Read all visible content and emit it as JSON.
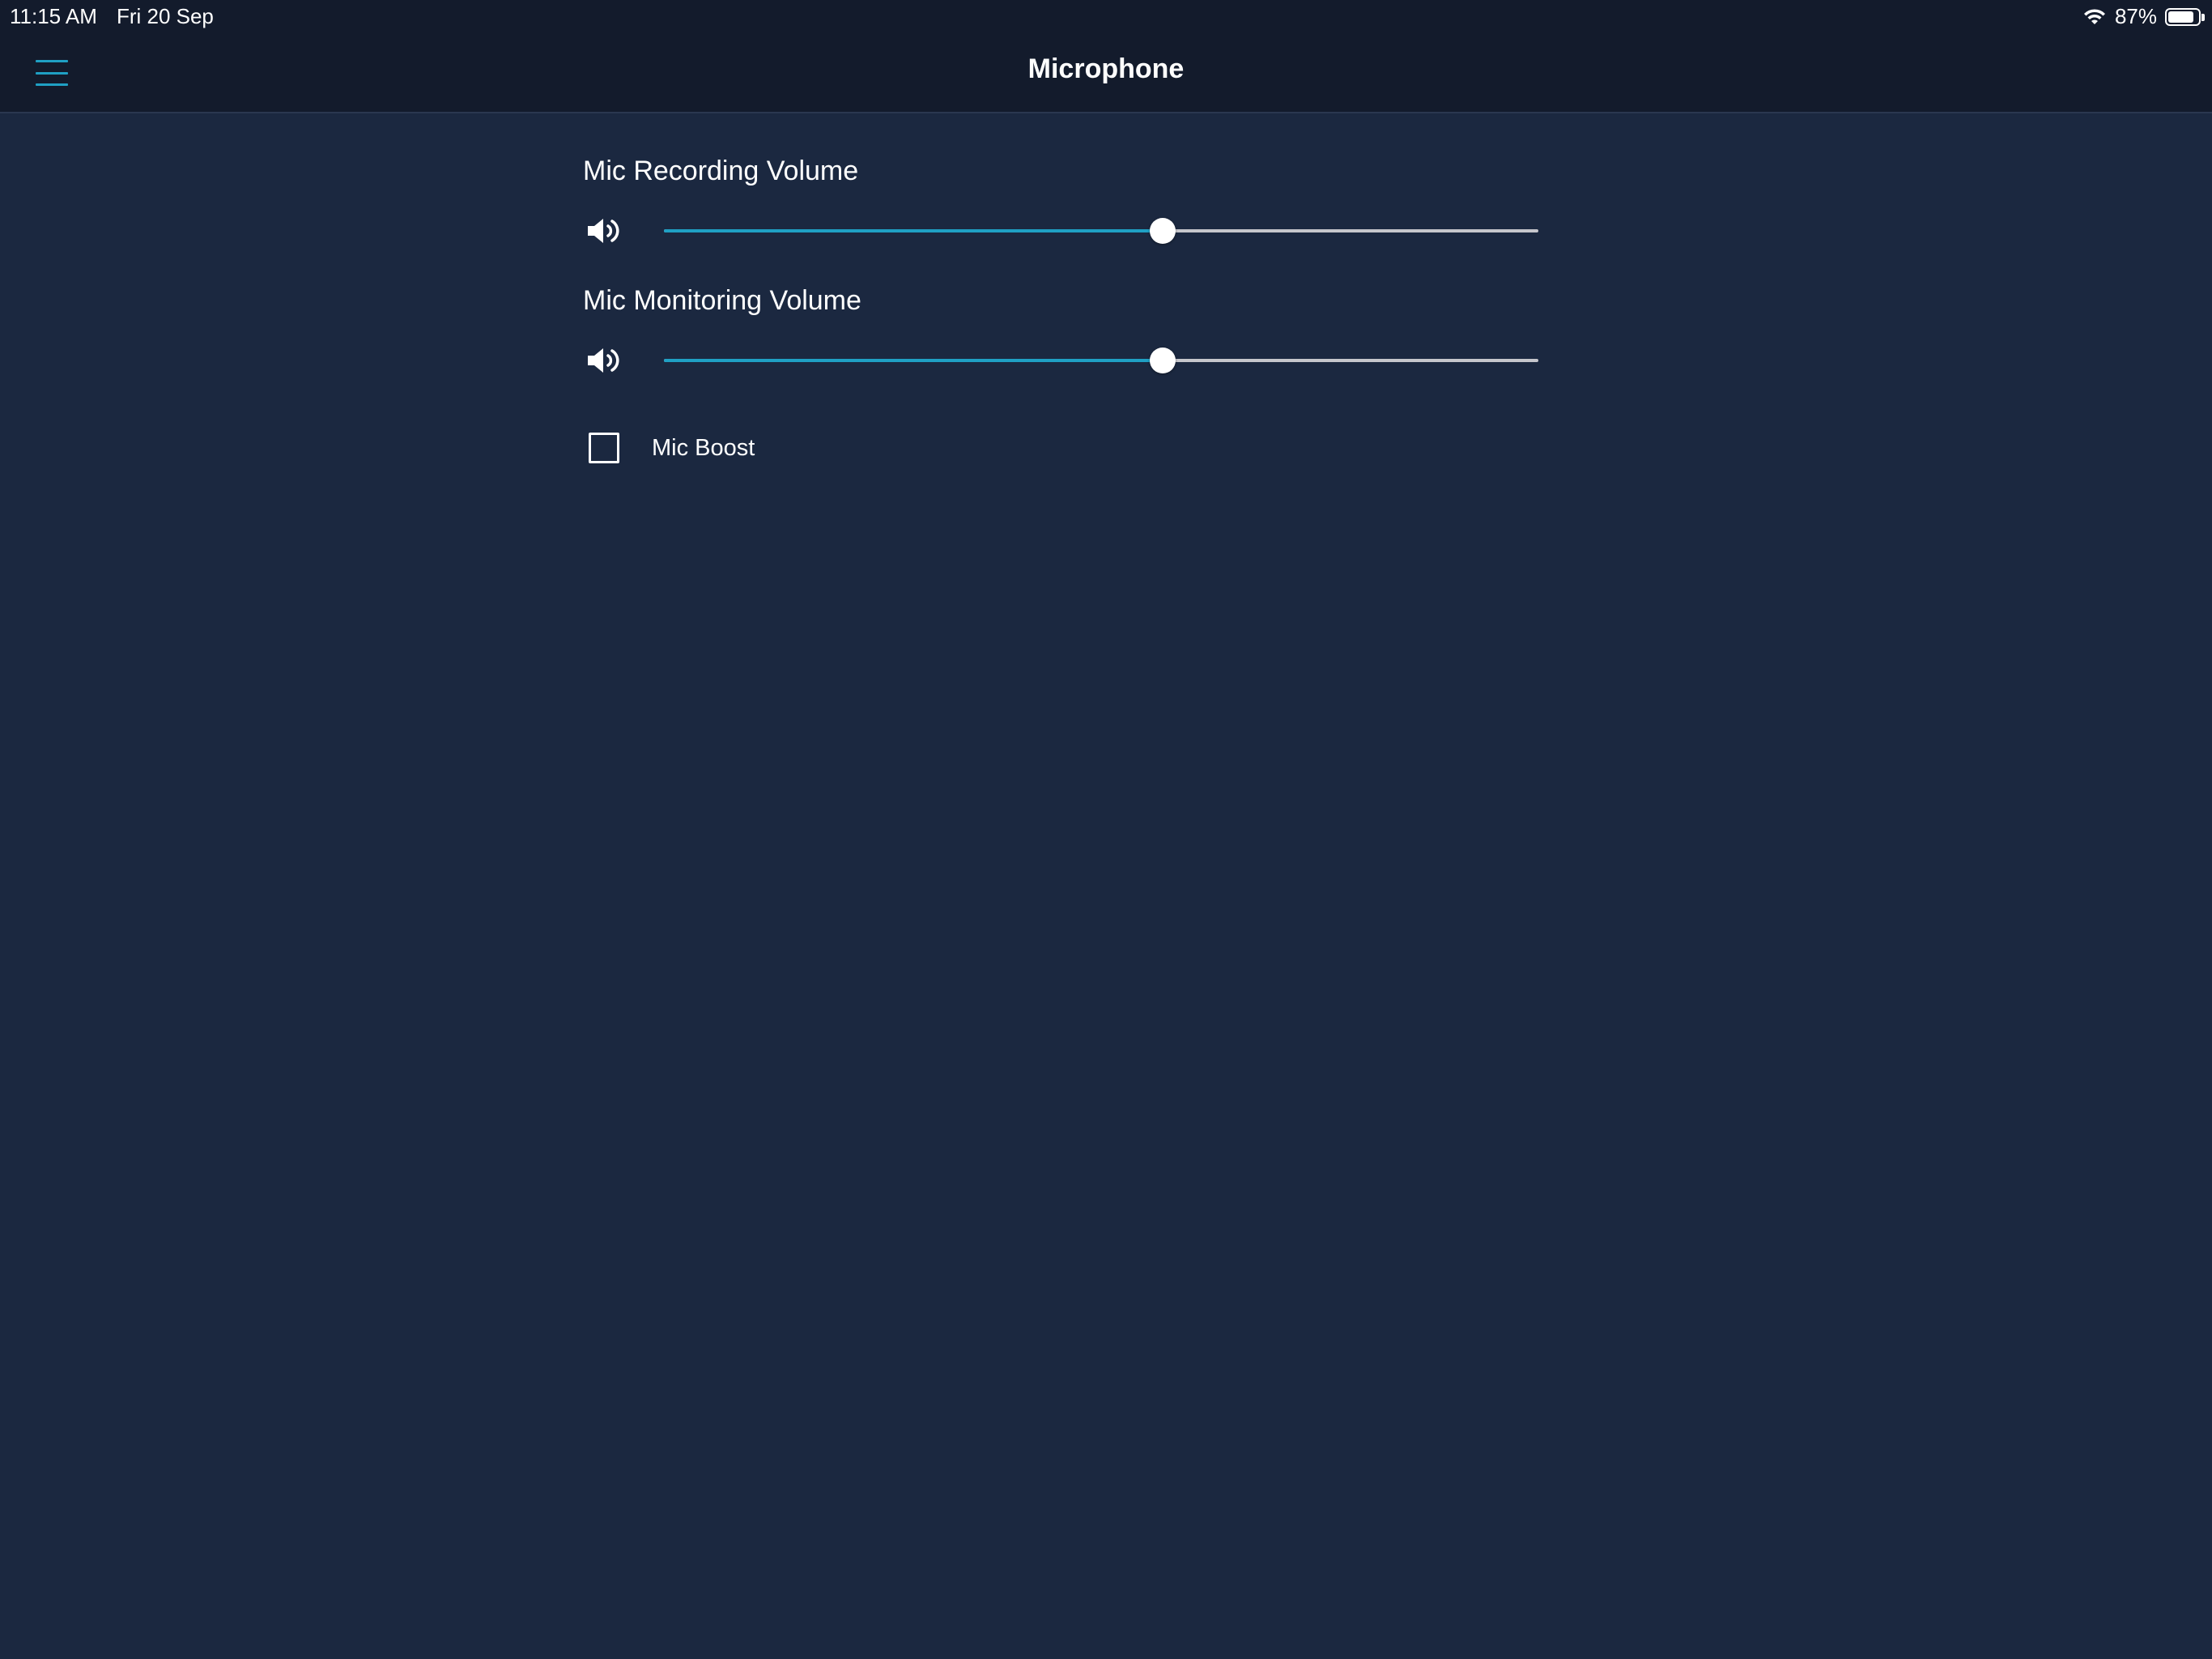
{
  "status_bar": {
    "time": "11:15 AM",
    "date": "Fri 20 Sep",
    "battery_percent": "87%",
    "battery_level": 0.87,
    "wifi_icon": "wifi-icon",
    "battery_icon": "battery-icon"
  },
  "nav": {
    "title": "Microphone",
    "menu_icon": "hamburger-menu-icon"
  },
  "colors": {
    "background": "#1b2840",
    "bar_background": "#131b2c",
    "accent": "#1fa0c4",
    "track": "#c6c6cc"
  },
  "settings": {
    "recording": {
      "label": "Mic Recording Volume",
      "value": 0.57,
      "icon": "speaker-icon"
    },
    "monitoring": {
      "label": "Mic Monitoring Volume",
      "value": 0.57,
      "icon": "speaker-icon"
    },
    "boost": {
      "label": "Mic Boost",
      "checked": false
    }
  }
}
